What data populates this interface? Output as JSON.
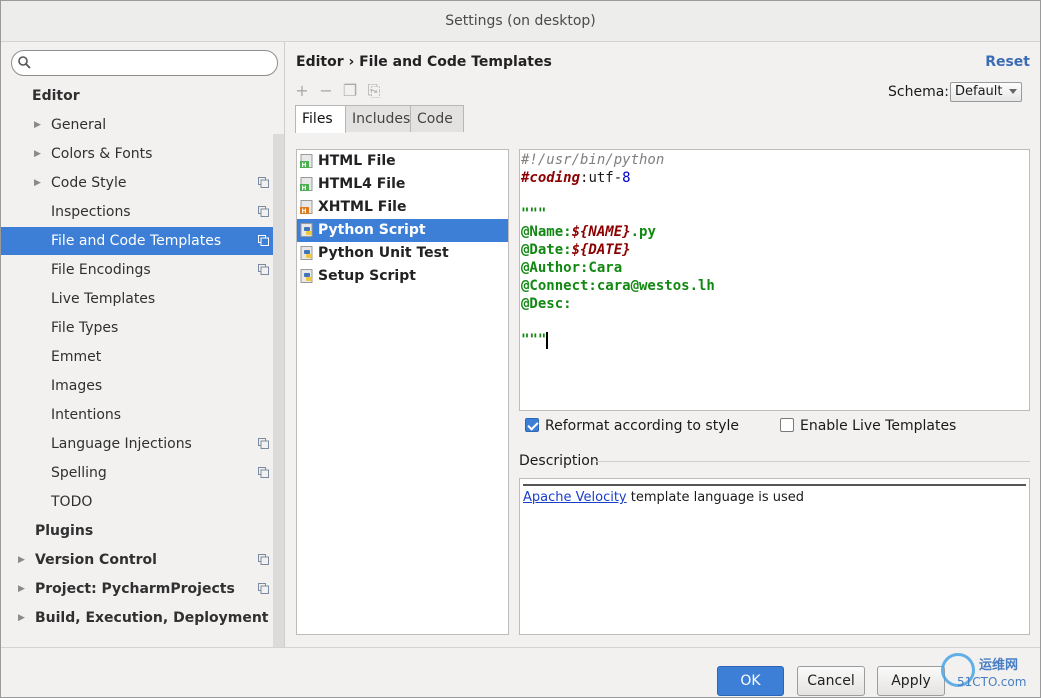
{
  "window": {
    "title": "Settings (on desktop)"
  },
  "search": {
    "placeholder": ""
  },
  "sidebar": {
    "items": [
      {
        "label": "Editor",
        "level": 0,
        "bold": true,
        "arrow": false,
        "project_icon": false,
        "selected": false
      },
      {
        "label": "General",
        "level": 1,
        "bold": false,
        "arrow": true,
        "project_icon": false,
        "selected": false
      },
      {
        "label": "Colors & Fonts",
        "level": 1,
        "bold": false,
        "arrow": true,
        "project_icon": false,
        "selected": false
      },
      {
        "label": "Code Style",
        "level": 1,
        "bold": false,
        "arrow": true,
        "project_icon": true,
        "selected": false
      },
      {
        "label": "Inspections",
        "level": 1,
        "bold": false,
        "arrow": false,
        "project_icon": true,
        "selected": false
      },
      {
        "label": "File and Code Templates",
        "level": 1,
        "bold": false,
        "arrow": false,
        "project_icon": true,
        "selected": true
      },
      {
        "label": "File Encodings",
        "level": 1,
        "bold": false,
        "arrow": false,
        "project_icon": true,
        "selected": false
      },
      {
        "label": "Live Templates",
        "level": 1,
        "bold": false,
        "arrow": false,
        "project_icon": false,
        "selected": false
      },
      {
        "label": "File Types",
        "level": 1,
        "bold": false,
        "arrow": false,
        "project_icon": false,
        "selected": false
      },
      {
        "label": "Emmet",
        "level": 1,
        "bold": false,
        "arrow": false,
        "project_icon": false,
        "selected": false
      },
      {
        "label": "Images",
        "level": 1,
        "bold": false,
        "arrow": false,
        "project_icon": false,
        "selected": false
      },
      {
        "label": "Intentions",
        "level": 1,
        "bold": false,
        "arrow": false,
        "project_icon": false,
        "selected": false
      },
      {
        "label": "Language Injections",
        "level": 1,
        "bold": false,
        "arrow": false,
        "project_icon": true,
        "selected": false
      },
      {
        "label": "Spelling",
        "level": 1,
        "bold": false,
        "arrow": false,
        "project_icon": true,
        "selected": false
      },
      {
        "label": "TODO",
        "level": 1,
        "bold": false,
        "arrow": false,
        "project_icon": false,
        "selected": false
      },
      {
        "label": "Plugins",
        "level": 0,
        "bold": true,
        "arrow": false,
        "project_icon": false,
        "selected": false
      },
      {
        "label": "Version Control",
        "level": 0,
        "bold": true,
        "arrow": true,
        "project_icon": true,
        "selected": false
      },
      {
        "label": "Project: PycharmProjects",
        "level": 0,
        "bold": true,
        "arrow": true,
        "project_icon": true,
        "selected": false
      },
      {
        "label": "Build, Execution, Deployment",
        "level": 0,
        "bold": true,
        "arrow": true,
        "project_icon": false,
        "selected": false
      }
    ]
  },
  "header": {
    "breadcrumb": "Editor › File and Code Templates",
    "reset": "Reset"
  },
  "schema": {
    "label": "Schema:",
    "value": "Default"
  },
  "tabs": [
    {
      "label": "Files",
      "active": true
    },
    {
      "label": "Includes",
      "active": false
    },
    {
      "label": "Code",
      "active": false
    }
  ],
  "files": [
    {
      "name": "HTML File",
      "icon": "html-file-icon",
      "selected": false
    },
    {
      "name": "HTML4 File",
      "icon": "html4-file-icon",
      "selected": false
    },
    {
      "name": "XHTML File",
      "icon": "xhtml-file-icon",
      "selected": false
    },
    {
      "name": "Python Script",
      "icon": "python-file-icon",
      "selected": true
    },
    {
      "name": "Python Unit Test",
      "icon": "python-file-icon",
      "selected": false
    },
    {
      "name": "Setup Script",
      "icon": "python-file-icon",
      "selected": false
    }
  ],
  "editor": {
    "lines": [
      [
        {
          "t": "#!/usr/bin/python",
          "c": "c-comment"
        }
      ],
      [
        {
          "t": "#coding",
          "c": "c-key"
        },
        {
          "t": ":utf-",
          "c": "c-norm"
        },
        {
          "t": "8",
          "c": "c-num"
        }
      ],
      [],
      [
        {
          "t": "\"\"\"",
          "c": "c-green"
        }
      ],
      [
        {
          "t": "@Name:",
          "c": "c-green"
        },
        {
          "t": "${NAME}",
          "c": "c-var"
        },
        {
          "t": ".py",
          "c": "c-green"
        }
      ],
      [
        {
          "t": "@Date:",
          "c": "c-green"
        },
        {
          "t": "${DATE}",
          "c": "c-var"
        }
      ],
      [
        {
          "t": "@Author:Cara",
          "c": "c-green"
        }
      ],
      [
        {
          "t": "@Connect:cara@westos.lh",
          "c": "c-green"
        }
      ],
      [
        {
          "t": "@Desc:",
          "c": "c-green"
        }
      ],
      [],
      [
        {
          "t": "\"\"\"",
          "c": "c-green"
        }
      ]
    ]
  },
  "options": {
    "reformat": {
      "label": "Reformat according to style",
      "checked": true
    },
    "live_templates": {
      "label": "Enable Live Templates",
      "checked": false
    }
  },
  "description": {
    "label": "Description",
    "link": "Apache Velocity",
    "text": " template language is used"
  },
  "buttons": {
    "ok": "OK",
    "cancel": "Cancel",
    "apply": "Apply"
  },
  "watermark": {
    "top": "运维网",
    "bottom": "51CTO.com"
  }
}
